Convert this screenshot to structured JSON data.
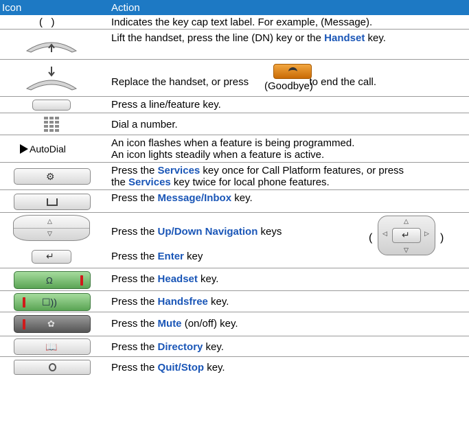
{
  "header": {
    "col_icon": "Icon",
    "col_action": "Action"
  },
  "rows": {
    "keycap": {
      "icon_text": "(   )",
      "text": "Indicates the key cap text label. For example, (Message)."
    },
    "lift": {
      "t1": "Lift the handset, press the line (DN) key or the ",
      "b1": "Handset",
      "t2": " key."
    },
    "replace": {
      "t1": "Replace the handset, or press ",
      "goodbye": "(Goodbye)",
      "t2": " to end the call."
    },
    "line_feature": {
      "text": "Press a line/feature key."
    },
    "dial": {
      "text": "Dial a number."
    },
    "autodial": {
      "icon_text": "AutoDial",
      "line1": "An icon flashes when a feature is being programmed.",
      "line2": "An icon lights steadily when a feature is active."
    },
    "services": {
      "t1": "Press the ",
      "b1": "Services",
      "t2": " key once for Call Platform features, or press",
      "t3": "the ",
      "b2": "Services",
      "t4": " key twice for local phone features."
    },
    "message": {
      "t1": "Press the ",
      "b1": "Message/Inbox",
      "t2": " key."
    },
    "navigation": {
      "t1": "Press the ",
      "b1": "Up/Down Navigation",
      "t2": " keys"
    },
    "enter": {
      "t1": "Press the ",
      "b1": "Enter",
      "t2": " key"
    },
    "headset": {
      "t1": "Press the ",
      "b1": "Headset",
      "t2": " key."
    },
    "handsfree": {
      "t1": "Press the ",
      "b1": "Handsfree",
      "t2": " key."
    },
    "mute": {
      "t1": "Press the ",
      "b1": "Mute",
      "t2": " (on/off) key."
    },
    "directory": {
      "t1": "Press the ",
      "b1": "Directory",
      "t2": " key."
    },
    "quit": {
      "t1": "Press the ",
      "b1": "Quit/Stop",
      "t2": " key."
    }
  },
  "nav_cluster": {
    "open": "(",
    "close": ")"
  }
}
